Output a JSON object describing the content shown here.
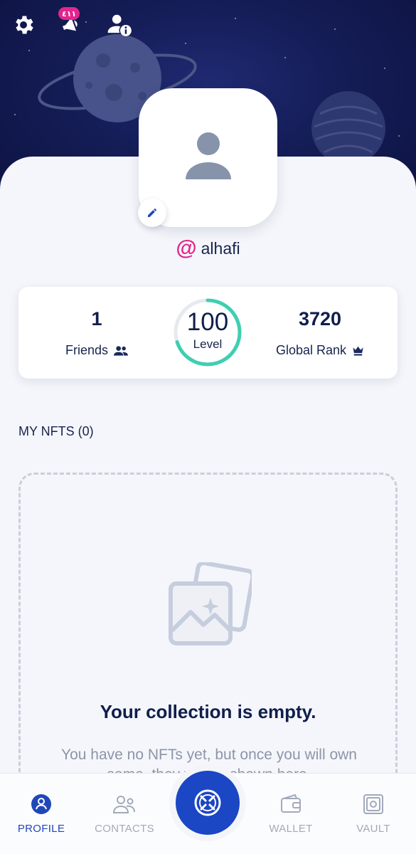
{
  "header": {
    "settings_icon": "gear-icon",
    "notifications_icon": "megaphone-icon",
    "notifications_badge": "٤١١",
    "user_info_icon": "user-info-icon"
  },
  "profile": {
    "at_symbol": "@",
    "username": "alhafi"
  },
  "stats": {
    "friends_value": "1",
    "friends_label": "Friends",
    "level_value": "100",
    "level_label": "Level",
    "level_progress": 0.7,
    "rank_value": "3720",
    "rank_label": "Global Rank"
  },
  "nfts": {
    "section_title": "MY NFTS (0)",
    "empty_title": "Your collection is empty.",
    "empty_desc": "You have no NFTs yet, but once you will own some, they will be shown here."
  },
  "nav": {
    "profile": "PROFILE",
    "contacts": "CONTACTS",
    "wallet": "WALLET",
    "vault": "VAULT"
  },
  "colors": {
    "accent": "#1b46c4",
    "pink": "#e3258d",
    "teal": "#3ecfb1",
    "navy": "#0f1e4c"
  }
}
